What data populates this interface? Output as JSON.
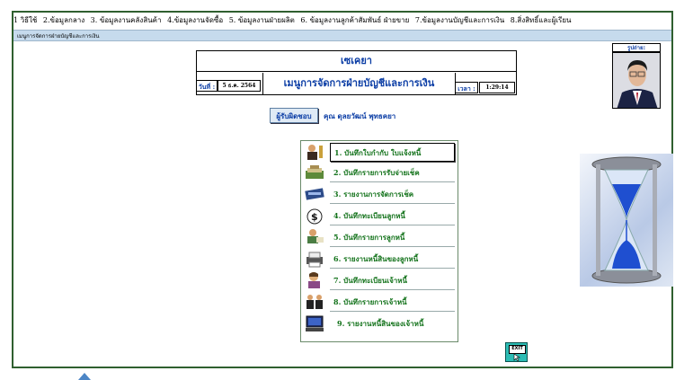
{
  "menubar": [
    "1 วิธีใช้",
    "2.ข้อมูลกลาง",
    "3. ข้อมูลงานคลังสินค้า",
    "4.ข้อมูลงานจัดซื้อ",
    "5. ข้อมูลงานฝ่ายผลิต",
    "6. ข้อมูลงานลูกค้าสัมพันธ์ ฝ่ายขาย",
    "7.ข้อมูลงานบัญชีและการเงิน",
    "8.สิ่งสิทธิ์และผู้เรียน"
  ],
  "form_title": "เมนูการจัดการฝ่ายบัญชีและการเงิน",
  "header": {
    "company": "เซเคยา",
    "menu_title": "เมนูการจัดการฝ่ายบัญชีและการเงิน",
    "date_label": "วันที่ :",
    "date_value": "5 ธ.ค. 2564",
    "time_label": "เวลา :",
    "time_value": "1:29:14"
  },
  "responsible": {
    "button_label": "ผู้รับผิดชอบ",
    "name": "คุณ ดุลยวัฒน์ พุทธคยา"
  },
  "photo_label": "รูปถ่าย:",
  "menu_items": [
    "1. บันทึกใบกำกับ ใบแจ้งหนี้",
    "2. บันทึกรายการรับจ่ายเช็ค",
    "3. รายงานการจัดการเช็ค",
    "4. บันทึกทะเบียนลูกหนี้",
    "5. บันทึกรายการลูกหนี้",
    "6. รายงานหนี้สินของลูกหนี้",
    "7. บันทึกทะเบียนเจ้าหนี้",
    "8. บันทึกรายการเจ้าหนี้",
    "9. รายงานหนี้สินของเจ้าหนี้"
  ],
  "menu_icons": [
    "person-with-lamp-icon",
    "money-stack-icon",
    "check-book-icon",
    "dollar-bag-icon",
    "person-reading-icon",
    "printer-icon",
    "person-phone-icon",
    "people-meeting-icon",
    "computer-icon"
  ],
  "exit_button_label": "EXIT",
  "colors": {
    "title_blue": "#0b3da5",
    "item_green": "#12721a",
    "frame_green": "#2f5f2f",
    "formbar_blue": "#c6dbed",
    "exit_teal": "#2cbcb4"
  }
}
